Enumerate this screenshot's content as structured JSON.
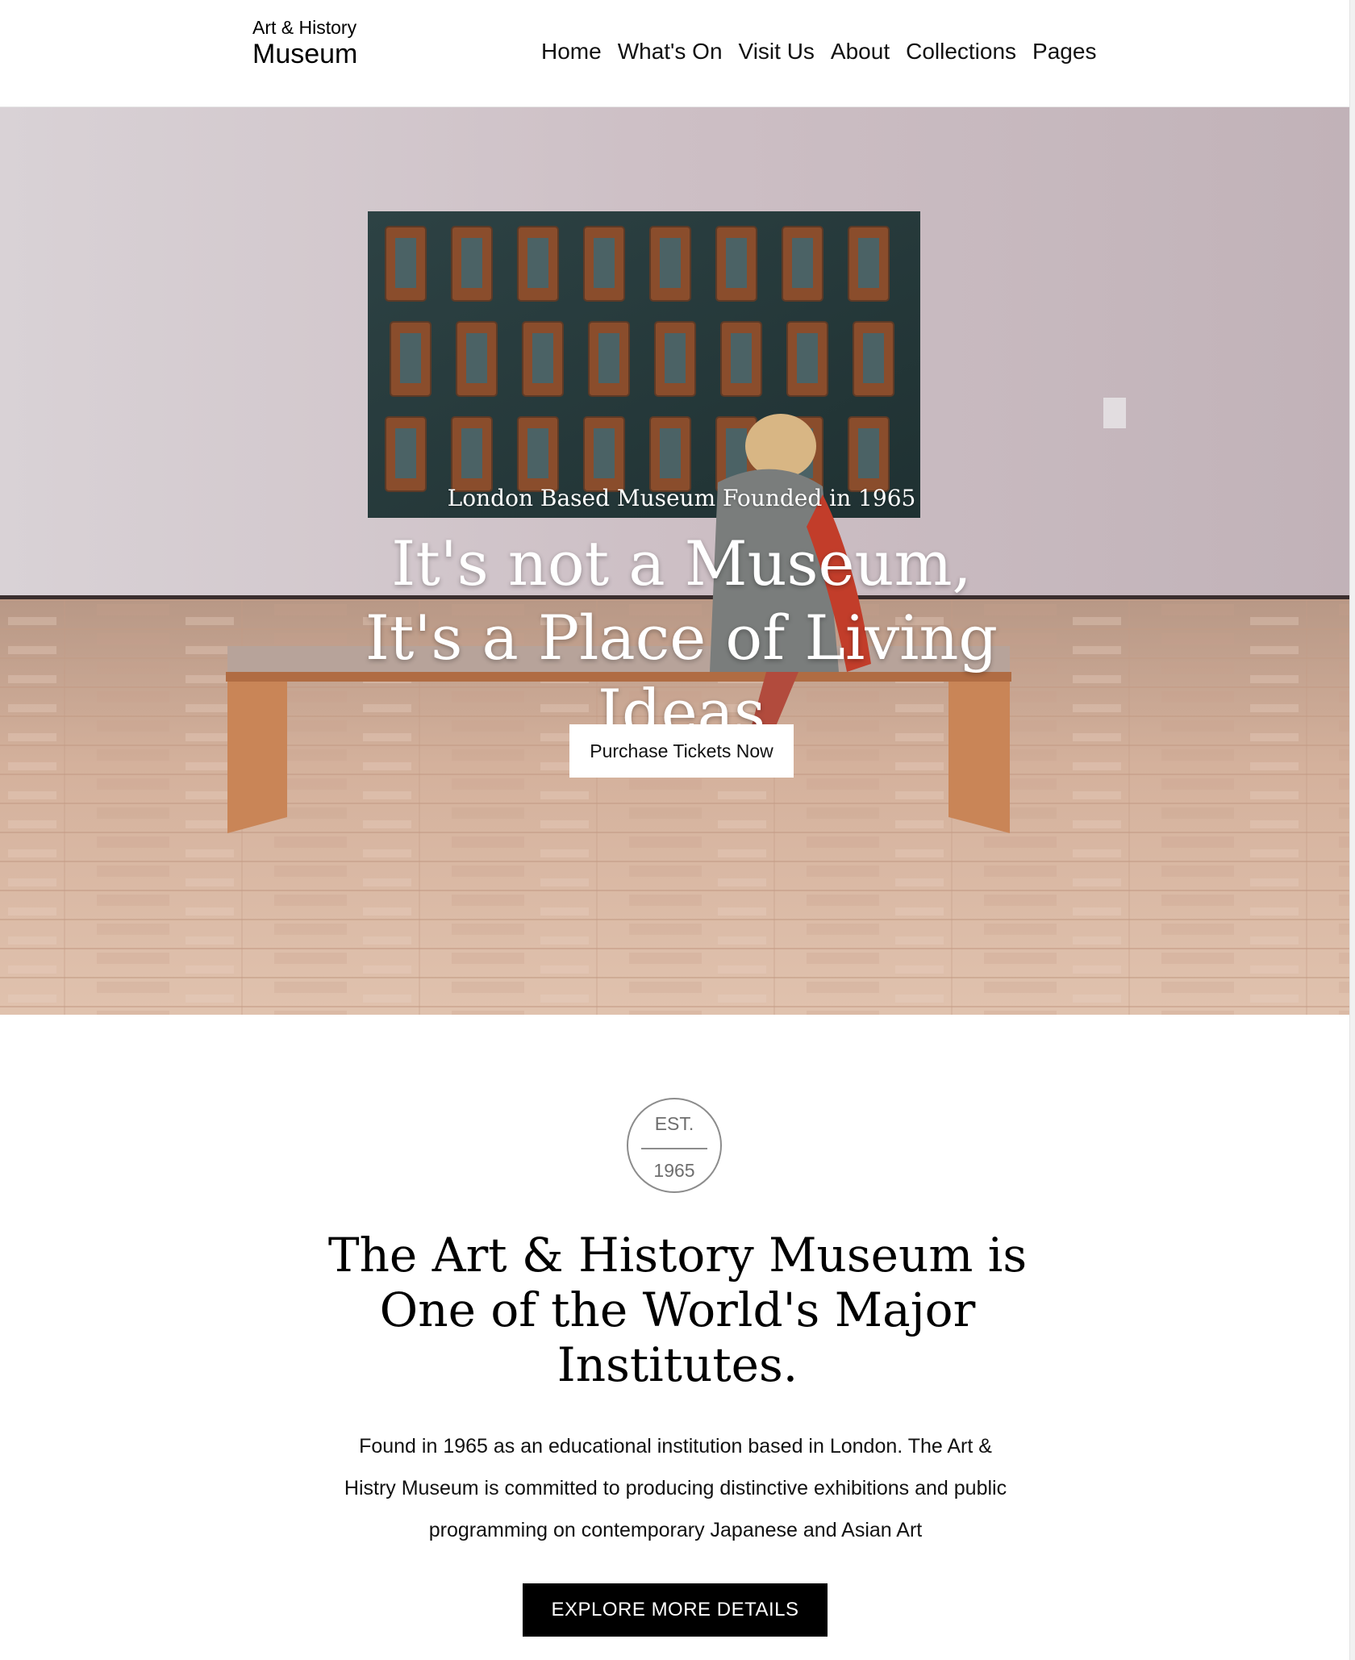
{
  "header": {
    "logo_top": "Art & History",
    "logo_main": "Museum",
    "nav": [
      {
        "label": "Home"
      },
      {
        "label": "What's On"
      },
      {
        "label": "Visit Us"
      },
      {
        "label": "About"
      },
      {
        "label": "Collections"
      },
      {
        "label": "Pages"
      }
    ]
  },
  "hero": {
    "subtitle": "London Based Museum Founded in 1965",
    "title": "It's not a Museum, It's a Place of Living Ideas",
    "button_label": "Purchase Tickets Now"
  },
  "intro": {
    "badge_top": "EST.",
    "badge_bottom": "1965",
    "title": "The Art & History Museum is One of the World's Major Institutes.",
    "text": "Found in 1965 as an educational institution based in London. The Art & Histry Museum is committed to producing distinctive exhibitions and public programming on contemporary Japanese and Asian Art",
    "button_label": "EXPLORE MORE DETAILS"
  }
}
